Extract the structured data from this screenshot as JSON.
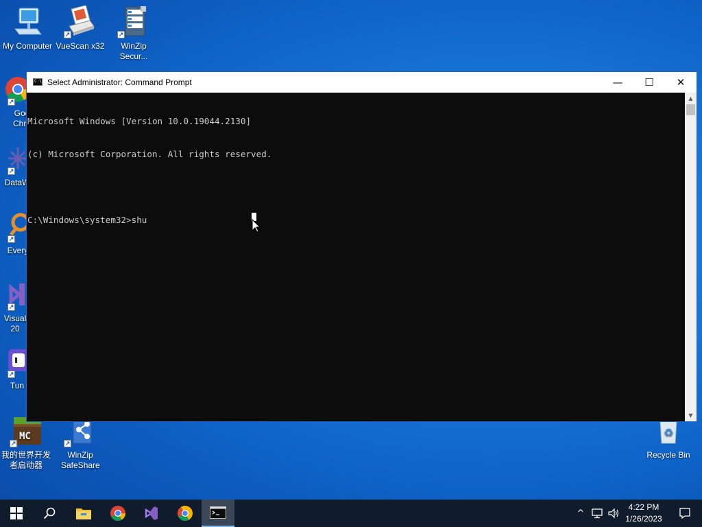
{
  "desktop": {
    "icons": [
      {
        "label": "My Computer"
      },
      {
        "label": "VueScan x32"
      },
      {
        "label": "WinZip Secur..."
      },
      {
        "label": "Goo Chro"
      },
      {
        "label": "DataW"
      },
      {
        "label": "Every"
      },
      {
        "label": "Visual 20"
      },
      {
        "label": "Tun"
      },
      {
        "label": "我的世界开发者启动器"
      },
      {
        "label": "WinZip SafeShare"
      },
      {
        "label": "Recycle Bin"
      }
    ],
    "mc_text": "MC"
  },
  "window": {
    "title": "Select Administrator: Command Prompt",
    "app_icon_text": "C:\\",
    "controls": {
      "minimize": "—",
      "maximize": "☐",
      "close": "✕"
    },
    "console_lines": [
      "Microsoft Windows [Version 10.0.19044.2130]",
      "(c) Microsoft Corporation. All rights reserved.",
      "",
      "C:\\Windows\\system32>shu"
    ]
  },
  "taskbar": {
    "start_icon": "windows-logo-icon",
    "items": [
      "search-icon",
      "file-explorer-icon",
      "chrome-icon",
      "visual-studio-icon",
      "chrome-alt-icon",
      "command-prompt-icon"
    ],
    "tray": {
      "chevron": "^"
    },
    "clock": {
      "time": "4:22 PM",
      "date": "1/26/2023"
    }
  },
  "colors": {
    "desktop": "#1676d6",
    "taskbar": "#101b2b",
    "console_bg": "#0c0c0c",
    "console_fg": "#cccccc"
  }
}
